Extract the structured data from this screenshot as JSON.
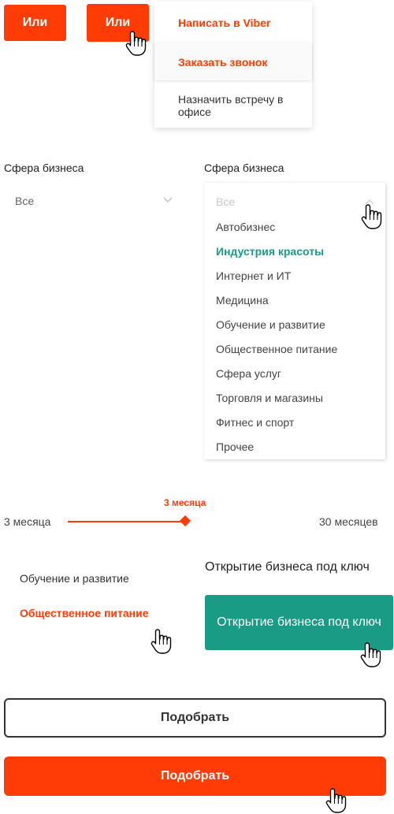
{
  "colors": {
    "accent": "#ff3b06",
    "green": "#1a9b86",
    "text": "#333333",
    "active_item": "#1a9b86"
  },
  "or_buttons": {
    "left_label": "Или",
    "right_label": "Или"
  },
  "contact_menu": {
    "items": [
      "Написать в Viber",
      "Заказать звонок",
      "Назначить встречу в офисе"
    ]
  },
  "business_select": {
    "label_left": "Сфера бизнеса",
    "value_left": "Все",
    "label_right": "Сфера бизнеса",
    "placeholder_right": "Все",
    "options": [
      "Автобизнес",
      "Индустрия красоты",
      "Интернет и ИТ",
      "Медицина",
      "Обучение и развитие",
      "Общественное питание",
      "Сфера услуг",
      "Торговля и магазины",
      "Фитнес и спорт",
      "Прочее"
    ],
    "active_option": "Индустрия красоты"
  },
  "term_slider": {
    "value_label": "3 месяца",
    "min_label": "3 месяца",
    "max_label": "30 месяцев",
    "value_months": 3,
    "fill_fraction": 1.0
  },
  "links": {
    "item_normal": "Обучение и развитие",
    "item_hover": "Общественное питание"
  },
  "turnkey": {
    "plain_label": "Открытие бизнеса под ключ",
    "button_label": "Открытие бизнеса под ключ"
  },
  "pick_buttons": {
    "outline_label": "Подобрать",
    "primary_label": "Подобрать"
  },
  "icons": {
    "cursor": "hand-pointer-icon",
    "chevron_down": "chevron-down-icon",
    "chevron_up": "chevron-up-icon"
  }
}
